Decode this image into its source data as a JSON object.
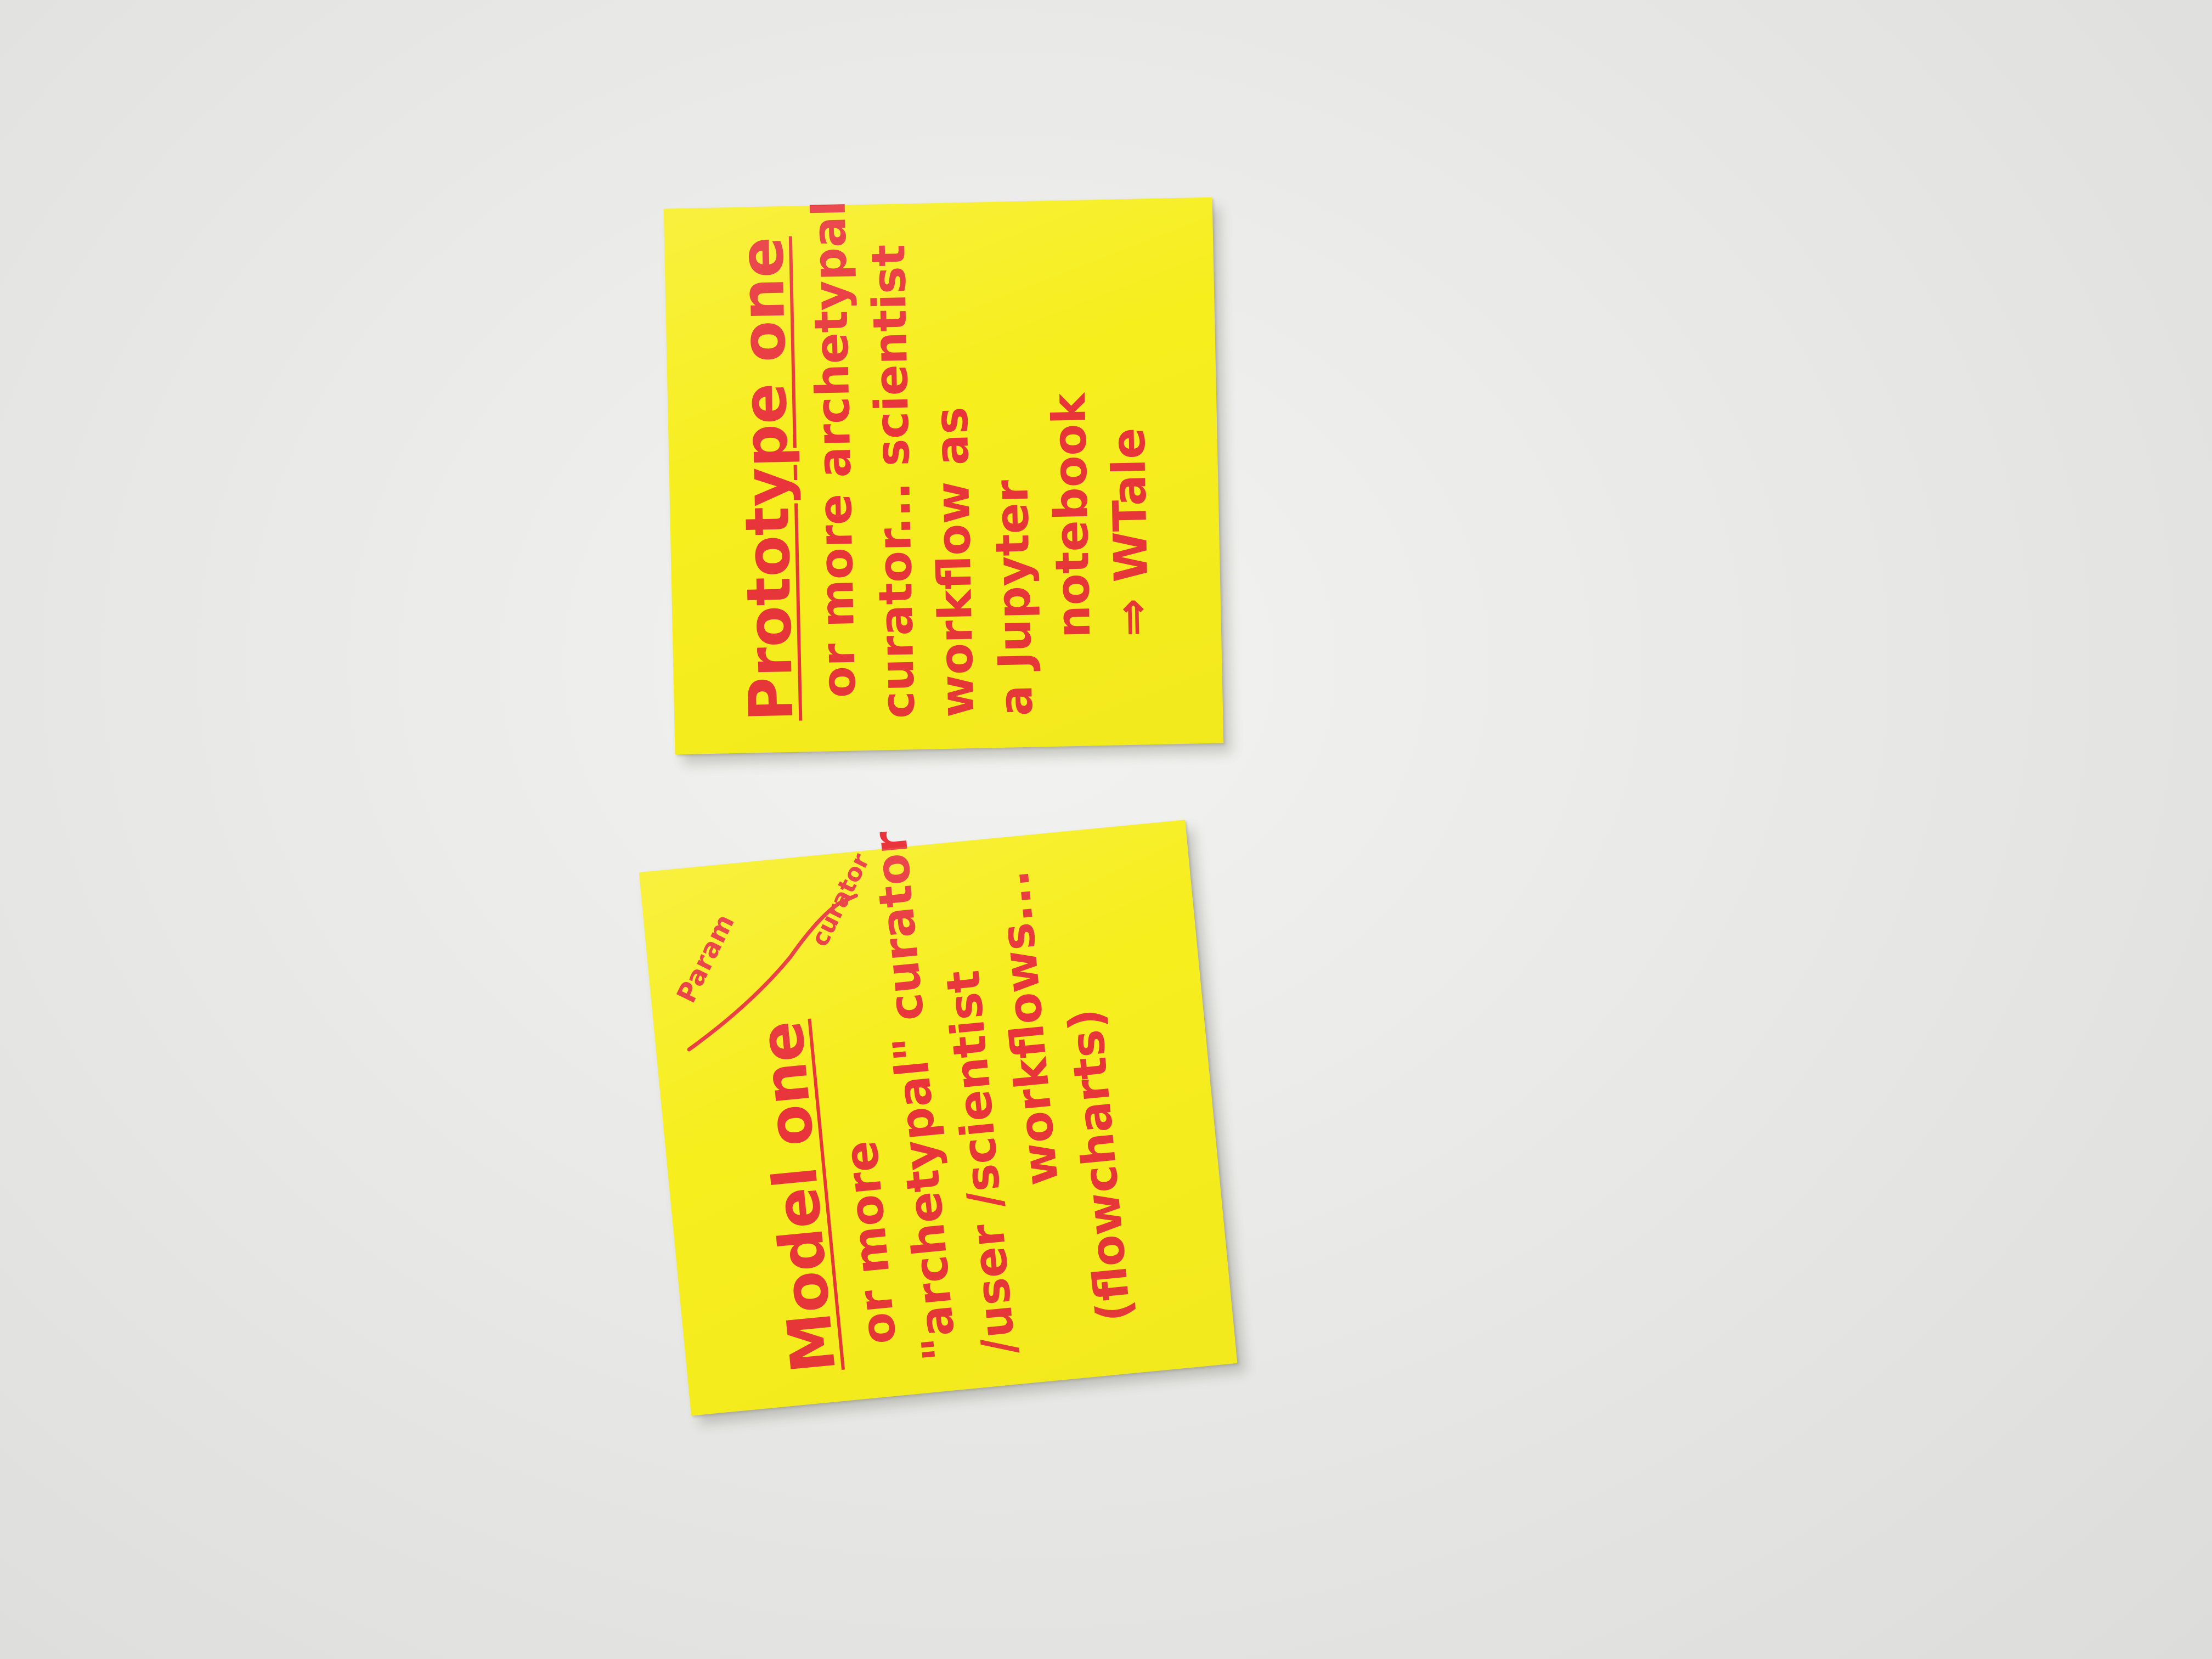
{
  "notes": [
    {
      "lines": [
        "Prototype one",
        "or more archetypal",
        "curator... scientist",
        "workflow as",
        "a Jupyter",
        "notebook",
        "⇒ WTale"
      ]
    },
    {
      "annotations": [
        "Param",
        "curator"
      ],
      "lines": [
        "Model one",
        "or more",
        "\"archetypal\" curator",
        "/user /scientist",
        "workflows...",
        "(flowcharts)"
      ]
    }
  ],
  "colors": {
    "wall": "#e9e9e7",
    "note": "#f7ee1e",
    "ink": "#e8343a"
  }
}
